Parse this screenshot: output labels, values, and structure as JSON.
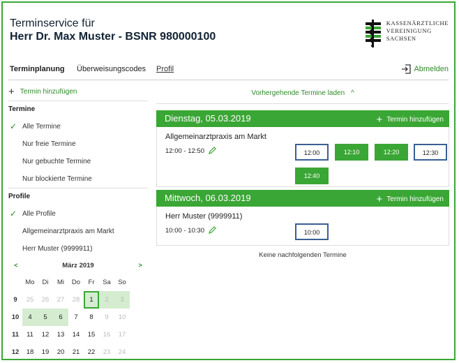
{
  "header": {
    "line1": "Terminservice für",
    "line2": "Herr Dr. Max Muster - BSNR 980000100",
    "logo_lines": [
      "Kassenärztliche",
      "Vereinigung",
      "Sachsen"
    ]
  },
  "nav": {
    "tabs": [
      "Terminplanung",
      "Überweisungscodes",
      "Profil"
    ],
    "logout": "Abmelden"
  },
  "sidebar": {
    "add": "Termin hinzufügen",
    "termine_head": "Termine",
    "termine_items": [
      "Alle Termine",
      "Nur freie Termine",
      "Nur gebuchte Termine",
      "Nur blockierte Termine"
    ],
    "profile_head": "Profile",
    "profile_items": [
      "Alle Profile",
      "Allgemeinarztpraxis am Markt",
      "Herr Muster (9999911)"
    ]
  },
  "calendar": {
    "prev": "<",
    "next": ">",
    "month": "März 2019",
    "dow": [
      "Mo",
      "Di",
      "Mi",
      "Do",
      "Fr",
      "Sa",
      "So"
    ],
    "weeks": [
      {
        "wk": "9",
        "days": [
          "25",
          "26",
          "27",
          "28",
          "1",
          "2",
          "3"
        ]
      },
      {
        "wk": "10",
        "days": [
          "4",
          "5",
          "6",
          "7",
          "8",
          "9",
          "10"
        ]
      },
      {
        "wk": "11",
        "days": [
          "11",
          "12",
          "13",
          "14",
          "15",
          "16",
          "17"
        ]
      },
      {
        "wk": "12",
        "days": [
          "18",
          "19",
          "20",
          "21",
          "22",
          "23",
          "24"
        ]
      }
    ]
  },
  "main": {
    "vorher": "Vorhergehende Termine laden",
    "days": [
      {
        "date": "Dienstag, 05.03.2019",
        "add": "Termin hinzufügen",
        "practice": "Allgemeinarztpraxis am Markt",
        "time": "12:00 - 12:50",
        "slots": [
          "12:00",
          "12:10",
          "12:20",
          "12:30",
          "12:40"
        ]
      },
      {
        "date": "Mittwoch, 06.03.2019",
        "add": "Termin hinzufügen",
        "practice": "Herr Muster (9999911)",
        "time": "10:00 - 10:30",
        "slots": [
          "10:00"
        ]
      }
    ],
    "keine": "Keine nachfolgenden Termine"
  },
  "colors": {
    "accent": "#3aa635",
    "free_border": "#3a5f93"
  }
}
